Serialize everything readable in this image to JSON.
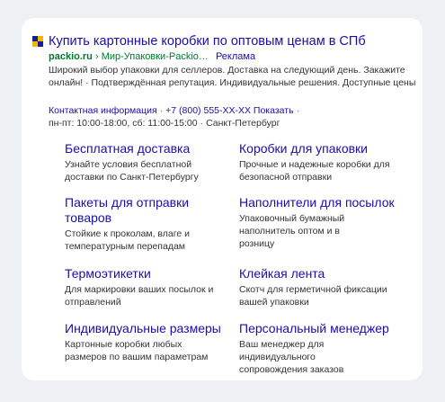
{
  "ad": {
    "title": "Купить картонные коробки по оптовым ценам в СПб",
    "domain": "packio.ru",
    "path": "› Мир-Упаковки-Packio…",
    "ad_label": "Реклама",
    "description": "Широкий выбор упаковки для селлеров. Доставка на следующий день. Закажите онлайн! · Подтверждённая репутация. Индивидуальные решения. Доступные цены",
    "contact_link": "Контактная информация",
    "phone": "+7 (800) 555-XX-XX",
    "phone_action": "Показать",
    "hours": "пн-пт: 10:00-18:00, сб: 11:00-15:00",
    "city": "Санкт-Петербург"
  },
  "sitelinks": [
    {
      "title": "Бесплатная доставка",
      "text": "Узнайте условия бесплатной доставки по Санкт-Петербургу"
    },
    {
      "title": "Коробки для упаковки",
      "text": "Прочные и надежные коробки для безопасной отправки"
    },
    {
      "title": "Пакеты для отправки товаров",
      "text": "Стойкие к проколам, влаге и температурным перепадам"
    },
    {
      "title": "Наполнители для посылок",
      "text": "Упаковочный бумажный наполнитель оптом и в розницу"
    },
    {
      "title": "Термоэтикетки",
      "text": "Для маркировки ваших посылок и отправлений"
    },
    {
      "title": "Клейкая лента",
      "text": "Скотч для герметичной фиксации вашей упаковки"
    },
    {
      "title": "Индивидуальные размеры",
      "text": "Картонные коробки любых размеров по вашим параметрам"
    },
    {
      "title": "Персональный менеджер",
      "text": "Ваш менеджер для индивидуального сопровождения заказов"
    }
  ]
}
